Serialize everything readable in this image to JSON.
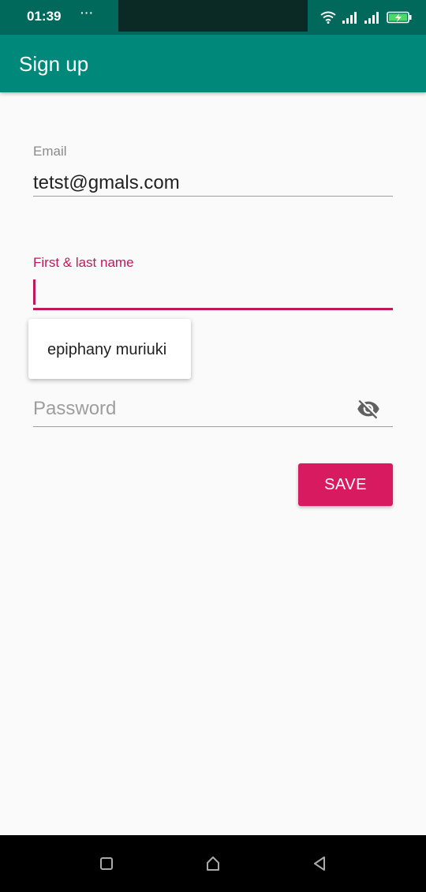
{
  "status_bar": {
    "time": "01:39",
    "more": "···",
    "icons": [
      "wifi-icon",
      "signal-icon",
      "signal-icon",
      "battery-charging-icon"
    ]
  },
  "app_bar": {
    "title": "Sign up"
  },
  "form": {
    "email": {
      "label": "Email",
      "value": "tetst@gmals.com"
    },
    "name": {
      "label": "First & last name",
      "value": ""
    },
    "autocomplete": {
      "suggestion": "epiphany muriuki"
    },
    "password": {
      "placeholder": "Password",
      "toggle_icon": "visibility-off-icon"
    },
    "save_label": "SAVE"
  },
  "nav_bar": {
    "icons": [
      "recents-icon",
      "home-icon",
      "back-icon"
    ]
  },
  "colors": {
    "status_bar": "#00695c",
    "app_bar": "#00897b",
    "accent": "#d81b60",
    "background": "#fafafa"
  }
}
